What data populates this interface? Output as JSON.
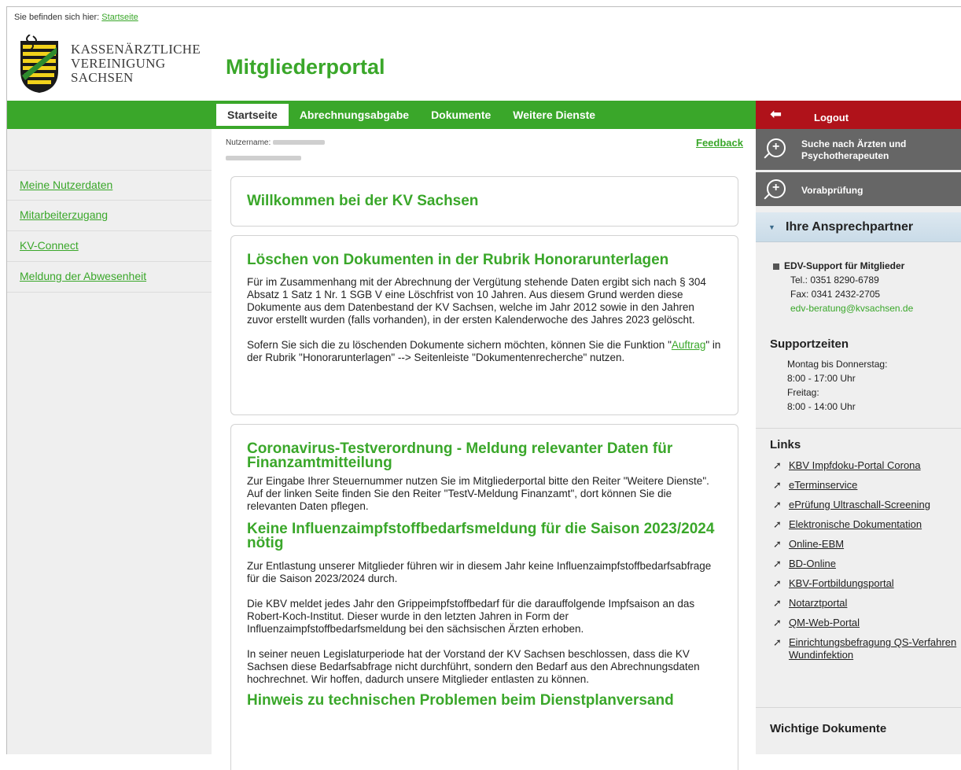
{
  "breadcrumb": {
    "prefix": "Sie befinden sich hier:",
    "link": "Startseite"
  },
  "logo": {
    "line1": "KASSENÄRZTLICHE",
    "line2": "VEREINIGUNG",
    "line3": "SACHSEN"
  },
  "portal_title": "Mitgliederportal",
  "nav": {
    "tabs": [
      "Startseite",
      "Abrechnungsabgabe",
      "Dokumente",
      "Weitere Dienste"
    ],
    "active": 0
  },
  "logout": "Logout",
  "sidebar": {
    "items": [
      "Meine Nutzerdaten",
      "Mitarbeiterzugang",
      "KV-Connect",
      "Meldung der Abwesenheit"
    ]
  },
  "user": {
    "label": "Nutzername:"
  },
  "feedback": "Feedback",
  "cards": {
    "welcome": "Willkommen bei der KV Sachsen",
    "delete": {
      "title": "Löschen von Dokumenten in der Rubrik Honorarunterlagen",
      "p1": "Für im Zusammenhang mit der Abrechnung der Vergütung stehende Daten ergibt sich nach § 304 Absatz 1 Satz 1 Nr. 1 SGB V eine Löschfrist von 10 Jahren. Aus diesem Grund werden diese Dokumente aus dem Datenbestand der KV Sachsen, welche im Jahr 2012 sowie in den Jahren zuvor erstellt wurden (falls vorhanden), in der ersten Kalenderwoche des Jahres 2023 gelöscht.",
      "p2_before": "Sofern Sie sich die zu löschenden Dokumente sichern möchten, können Sie die Funktion \"",
      "p2_link": "Auftrag",
      "p2_after": "\" in der Rubrik \"Honorarunterlagen\" --> Seitenleiste \"Dokumentenrecherche\" nutzen."
    },
    "corona": {
      "title": "Coronavirus-Testverordnung - Meldung relevanter Daten für Finanzamtmitteilung",
      "p1": "Zur Eingabe Ihrer Steuernummer nutzen Sie im Mitgliederportal bitte den Reiter \"Weitere Dienste\". Auf der linken Seite finden Sie den Reiter \"TestV-Meldung Finanzamt\", dort können Sie die relevanten Daten pflegen."
    },
    "influenza": {
      "title": "Keine Influenzaimpfstoffbedarfsmeldung für die Saison 2023/2024 nötig",
      "p1": "Zur Entlastung unserer Mitglieder führen wir in diesem Jahr keine Influenzaimpfstoffbedarfsabfrage für die Saison 2023/2024 durch.",
      "p2": "Die KBV meldet jedes Jahr den Grippeimpfstoffbedarf für die darauffolgende Impfsaison an das Robert-Koch-Institut. Dieser wurde in den letzten Jahren in Form der Influenzaimpfstoffbedarfsmeldung bei den sächsischen Ärzten erhoben.",
      "p3": "In seiner neuen Legislaturperiode hat der Vorstand der KV Sachsen beschlossen, dass die KV Sachsen diese Bedarfsabfrage nicht durchführt, sondern den Bedarf aus den Abrechnungsdaten hochrechnet. Wir hoffen, dadurch unsere Mitglieder entlasten zu können."
    },
    "next_title": "Hinweis zu technischen Problemen beim Dienstplanversand"
  },
  "right": {
    "search": "Suche nach Ärzten und Psychotherapeuten",
    "vorab": "Vorabprüfung",
    "ansprech": "Ihre Ansprechpartner",
    "support": {
      "title": "EDV-Support für Mitglieder",
      "tel": "Tel.: 0351 8290-6789",
      "fax": "Fax: 0341 2432-2705",
      "email": "edv-beratung@kvsachsen.de"
    },
    "zeiten": {
      "title": "Supportzeiten",
      "l1": "Montag bis Donnerstag:",
      "l2": "8:00 - 17:00 Uhr",
      "l3": "Freitag:",
      "l4": "8:00 - 14:00 Uhr"
    },
    "links_title": "Links",
    "links": [
      "KBV Impfdoku-Portal Corona",
      "eTerminservice",
      "ePrüfung Ultraschall-Screening",
      "Elektronische Dokumentation",
      "Online-EBM",
      "BD-Online",
      "KBV-Fortbildungsportal",
      "Notarztportal",
      "QM-Web-Portal",
      "Einrichtungsbefragung QS-Verfahren Wundinfektion"
    ],
    "docs_title": "Wichtige Dokumente"
  },
  "colors": {
    "brand_green": "#3aa72a",
    "logout_red": "#b0121a",
    "panel_grey": "#666666"
  }
}
